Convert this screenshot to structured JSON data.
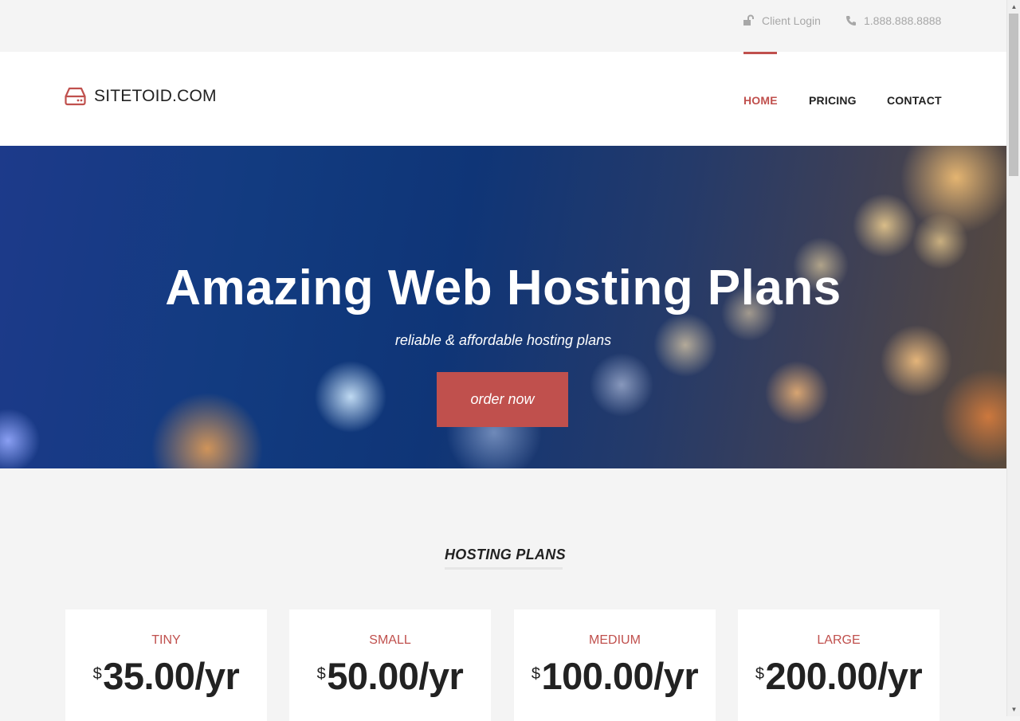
{
  "topbar": {
    "client_login": "Client Login",
    "phone": "1.888.888.8888"
  },
  "brand": {
    "name": "SITETOID.COM",
    "icon": "hard-drive-icon"
  },
  "nav": {
    "items": [
      {
        "label": "HOME",
        "active": true
      },
      {
        "label": "PRICING",
        "active": false
      },
      {
        "label": "CONTACT",
        "active": false
      }
    ]
  },
  "hero": {
    "title": "Amazing Web Hosting Plans",
    "subtitle": "reliable & affordable hosting plans",
    "cta": "order now"
  },
  "plans": {
    "title": "HOSTING PLANS",
    "currency": "$",
    "items": [
      {
        "name": "TINY",
        "price": "35.00/yr"
      },
      {
        "name": "SMALL",
        "price": "50.00/yr"
      },
      {
        "name": "MEDIUM",
        "price": "100.00/yr"
      },
      {
        "name": "LARGE",
        "price": "200.00/yr"
      }
    ]
  },
  "colors": {
    "accent": "#c0504d",
    "text": "#222222",
    "muted": "#a7a7a7",
    "background": "#f4f4f4"
  }
}
